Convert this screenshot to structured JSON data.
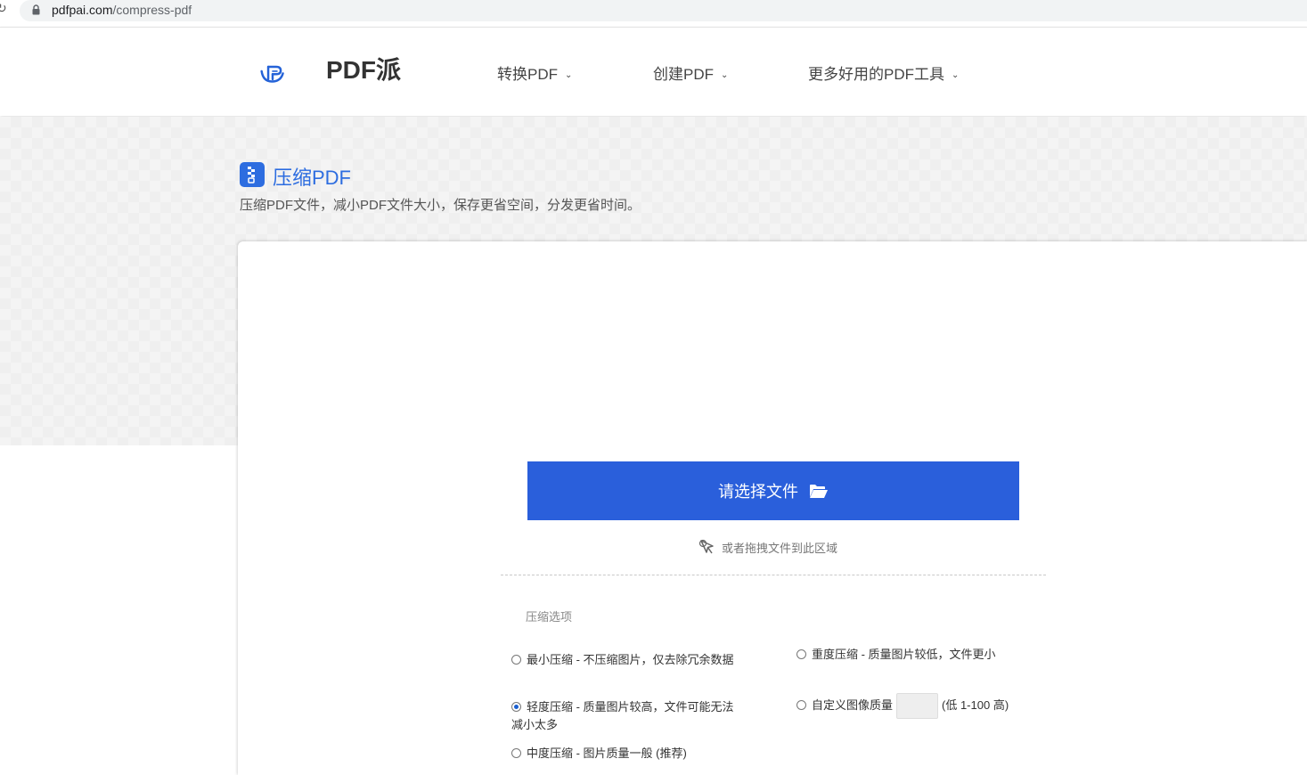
{
  "browser": {
    "url_host": "pdfpai.com",
    "url_path": "/compress-pdf"
  },
  "header": {
    "logo_text": "PDF派",
    "nav": [
      {
        "label": "转换PDF"
      },
      {
        "label": "创建PDF"
      },
      {
        "label": "更多好用的PDF工具"
      }
    ]
  },
  "tool": {
    "title": "压缩PDF",
    "description": "压缩PDF文件，减小PDF文件大小，保存更省空间，分发更省时间。"
  },
  "upload": {
    "button_label": "请选择文件",
    "drag_hint": "或者拖拽文件到此区域"
  },
  "options": {
    "heading": "压缩选项",
    "items": [
      {
        "label": "最小压缩 - 不压缩图片，仅去除冗余数据",
        "checked": false
      },
      {
        "label": "轻度压缩 - 质量图片较高，文件可能无法减小太多",
        "checked": true
      },
      {
        "label": "中度压缩 - 图片质量一般 (推荐)",
        "checked": false
      },
      {
        "label": "重度压缩 - 质量图片较低，文件更小",
        "checked": false
      },
      {
        "label": "自定义图像质量",
        "checked": false
      }
    ],
    "custom_quality_value": "",
    "custom_quality_hint": "(低 1-100 高)"
  },
  "colors": {
    "accent": "#2a5fdb",
    "title_blue": "#2d6de0"
  }
}
